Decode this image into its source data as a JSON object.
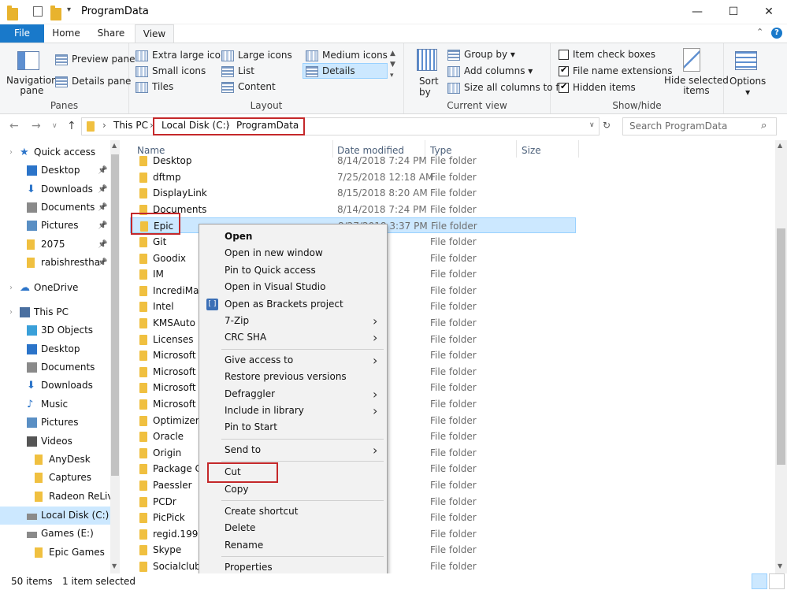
{
  "window": {
    "title": "ProgramData",
    "minimize": "—",
    "maximize": "☐",
    "close": "✕"
  },
  "ribbon_tabs": [
    "File",
    "Home",
    "Share",
    "View"
  ],
  "ribbon": {
    "panes": {
      "label": "Panes",
      "navigation_pane": "Navigation\npane",
      "preview_pane": "Preview pane",
      "details_pane": "Details pane"
    },
    "layout": {
      "label": "Layout",
      "options": [
        "Extra large icons",
        "Large icons",
        "Medium icons",
        "Small icons",
        "List",
        "Details",
        "Tiles",
        "Content"
      ],
      "selected": "Details"
    },
    "current_view": {
      "label": "Current view",
      "sort_by": "Sort\nby",
      "group_by": "Group by",
      "add_columns": "Add columns",
      "size_all_columns": "Size all columns to fit"
    },
    "show_hide": {
      "label": "Show/hide",
      "item_check_boxes": {
        "label": "Item check boxes",
        "checked": false
      },
      "file_name_extensions": {
        "label": "File name extensions",
        "checked": true
      },
      "hidden_items": {
        "label": "Hidden items",
        "checked": true
      },
      "hide_selected": "Hide selected\nitems"
    },
    "options": "Options"
  },
  "address": {
    "breadcrumbs": [
      "This PC",
      "Local Disk (C:)",
      "ProgramData"
    ],
    "search_placeholder": "Search ProgramData"
  },
  "nav_pane": [
    {
      "label": "Quick access",
      "icon": "star-icon",
      "indent": 0
    },
    {
      "label": "Desktop",
      "icon": "desktop-icon",
      "indent": 1,
      "pinned": true
    },
    {
      "label": "Downloads",
      "icon": "download-icon",
      "indent": 1,
      "pinned": true
    },
    {
      "label": "Documents",
      "icon": "document-icon",
      "indent": 1,
      "pinned": true
    },
    {
      "label": "Pictures",
      "icon": "pictures-icon",
      "indent": 1,
      "pinned": true
    },
    {
      "label": "2075",
      "icon": "folder-icon",
      "indent": 1,
      "pinned": true
    },
    {
      "label": "rabishrestha-",
      "icon": "folder-icon",
      "indent": 1,
      "pinned": true
    },
    {
      "label": "OneDrive",
      "icon": "cloud-icon",
      "indent": 0
    },
    {
      "label": "This PC",
      "icon": "computer-icon",
      "indent": 0
    },
    {
      "label": "3D Objects",
      "icon": "cube-icon",
      "indent": 1
    },
    {
      "label": "Desktop",
      "icon": "desktop-icon",
      "indent": 1
    },
    {
      "label": "Documents",
      "icon": "document-icon",
      "indent": 1
    },
    {
      "label": "Downloads",
      "icon": "download-icon",
      "indent": 1
    },
    {
      "label": "Music",
      "icon": "music-icon",
      "indent": 1
    },
    {
      "label": "Pictures",
      "icon": "pictures-icon",
      "indent": 1
    },
    {
      "label": "Videos",
      "icon": "video-icon",
      "indent": 1
    },
    {
      "label": "AnyDesk",
      "icon": "folder-icon",
      "indent": 2
    },
    {
      "label": "Captures",
      "icon": "folder-icon",
      "indent": 2
    },
    {
      "label": "Radeon ReLive",
      "icon": "folder-icon",
      "indent": 2
    },
    {
      "label": "Local Disk (C:)",
      "icon": "drive-icon",
      "indent": 1,
      "selected": true
    },
    {
      "label": "Games (E:)",
      "icon": "drive-icon",
      "indent": 1
    },
    {
      "label": "Epic Games",
      "icon": "folder-icon",
      "indent": 2
    }
  ],
  "columns": [
    "Name",
    "Date modified",
    "Type",
    "Size"
  ],
  "files": [
    {
      "name": "Desktop",
      "date": "8/14/2018 7:24 PM",
      "type": "File folder"
    },
    {
      "name": "dftmp",
      "date": "7/25/2018 12:18 AM",
      "type": "File folder"
    },
    {
      "name": "DisplayLink",
      "date": "8/15/2018 8:20 AM",
      "type": "File folder"
    },
    {
      "name": "Documents",
      "date": "8/14/2018 7:24 PM",
      "type": "File folder"
    },
    {
      "name": "Epic",
      "date": "8/27/2018 3:37 PM",
      "type": "File folder",
      "selected": true
    },
    {
      "name": "Git",
      "date": "50 PM",
      "type": "File folder"
    },
    {
      "name": "Goodix",
      "date": "37 AM",
      "type": "File folder"
    },
    {
      "name": "IM",
      "date": "50 PM",
      "type": "File folder"
    },
    {
      "name": "IncrediMail",
      "date": "38 PM",
      "type": "File folder"
    },
    {
      "name": "Intel",
      "date": "59 PM",
      "type": "File folder"
    },
    {
      "name": "KMSAuto",
      "date": "13 AM",
      "type": "File folder"
    },
    {
      "name": "Licenses",
      "date": "13 PM",
      "type": "File folder"
    },
    {
      "name": "Microsoft",
      "date": "07 PM",
      "type": "File folder"
    },
    {
      "name": "Microsoft O",
      "date": "27 PM",
      "type": "File folder"
    },
    {
      "name": "Microsoft S",
      "date": "1 AM",
      "type": "File folder"
    },
    {
      "name": "Microsoft V",
      "date": "55 PM",
      "type": "File folder"
    },
    {
      "name": "Optimizer",
      "date": "19 PM",
      "type": "File folder"
    },
    {
      "name": "Oracle",
      "date": "33 PM",
      "type": "File folder"
    },
    {
      "name": "Origin",
      "date": "37 PM",
      "type": "File folder"
    },
    {
      "name": "Package Ca",
      "date": "28 PM",
      "type": "File folder"
    },
    {
      "name": "Paessler",
      "date": "23 PM",
      "type": "File folder"
    },
    {
      "name": "PCDr",
      "date": "12 PM",
      "type": "File folder"
    },
    {
      "name": "PicPick",
      "date": "47 PM",
      "type": "File folder"
    },
    {
      "name": "regid.1991-",
      "date": "11 AM",
      "type": "File folder"
    },
    {
      "name": "Skype",
      "date": "21 AM",
      "type": "File folder"
    },
    {
      "name": "Socialclub",
      "date": "16 PM",
      "type": "File folder"
    }
  ],
  "context_menu": [
    {
      "label": "Open",
      "bold": true
    },
    {
      "label": "Open in new window"
    },
    {
      "label": "Pin to Quick access"
    },
    {
      "label": "Open in Visual Studio"
    },
    {
      "label": "Open as Brackets project",
      "icon": "brackets-icon"
    },
    {
      "label": "7-Zip",
      "submenu": true
    },
    {
      "label": "CRC SHA",
      "submenu": true
    },
    {
      "separator": true
    },
    {
      "label": "Give access to",
      "submenu": true
    },
    {
      "label": "Restore previous versions"
    },
    {
      "label": "Defraggler",
      "submenu": true
    },
    {
      "label": "Include in library",
      "submenu": true
    },
    {
      "label": "Pin to Start"
    },
    {
      "separator": true
    },
    {
      "label": "Send to",
      "submenu": true
    },
    {
      "separator": true
    },
    {
      "label": "Cut"
    },
    {
      "label": "Copy"
    },
    {
      "separator": true
    },
    {
      "label": "Create shortcut"
    },
    {
      "label": "Delete"
    },
    {
      "label": "Rename"
    },
    {
      "separator": true
    },
    {
      "label": "Properties"
    }
  ],
  "status": {
    "items": "50 items",
    "selected": "1 item selected"
  },
  "colors": {
    "accent": "#1979ca",
    "selection": "#cce8ff",
    "highlight_box": "#c4282a"
  }
}
